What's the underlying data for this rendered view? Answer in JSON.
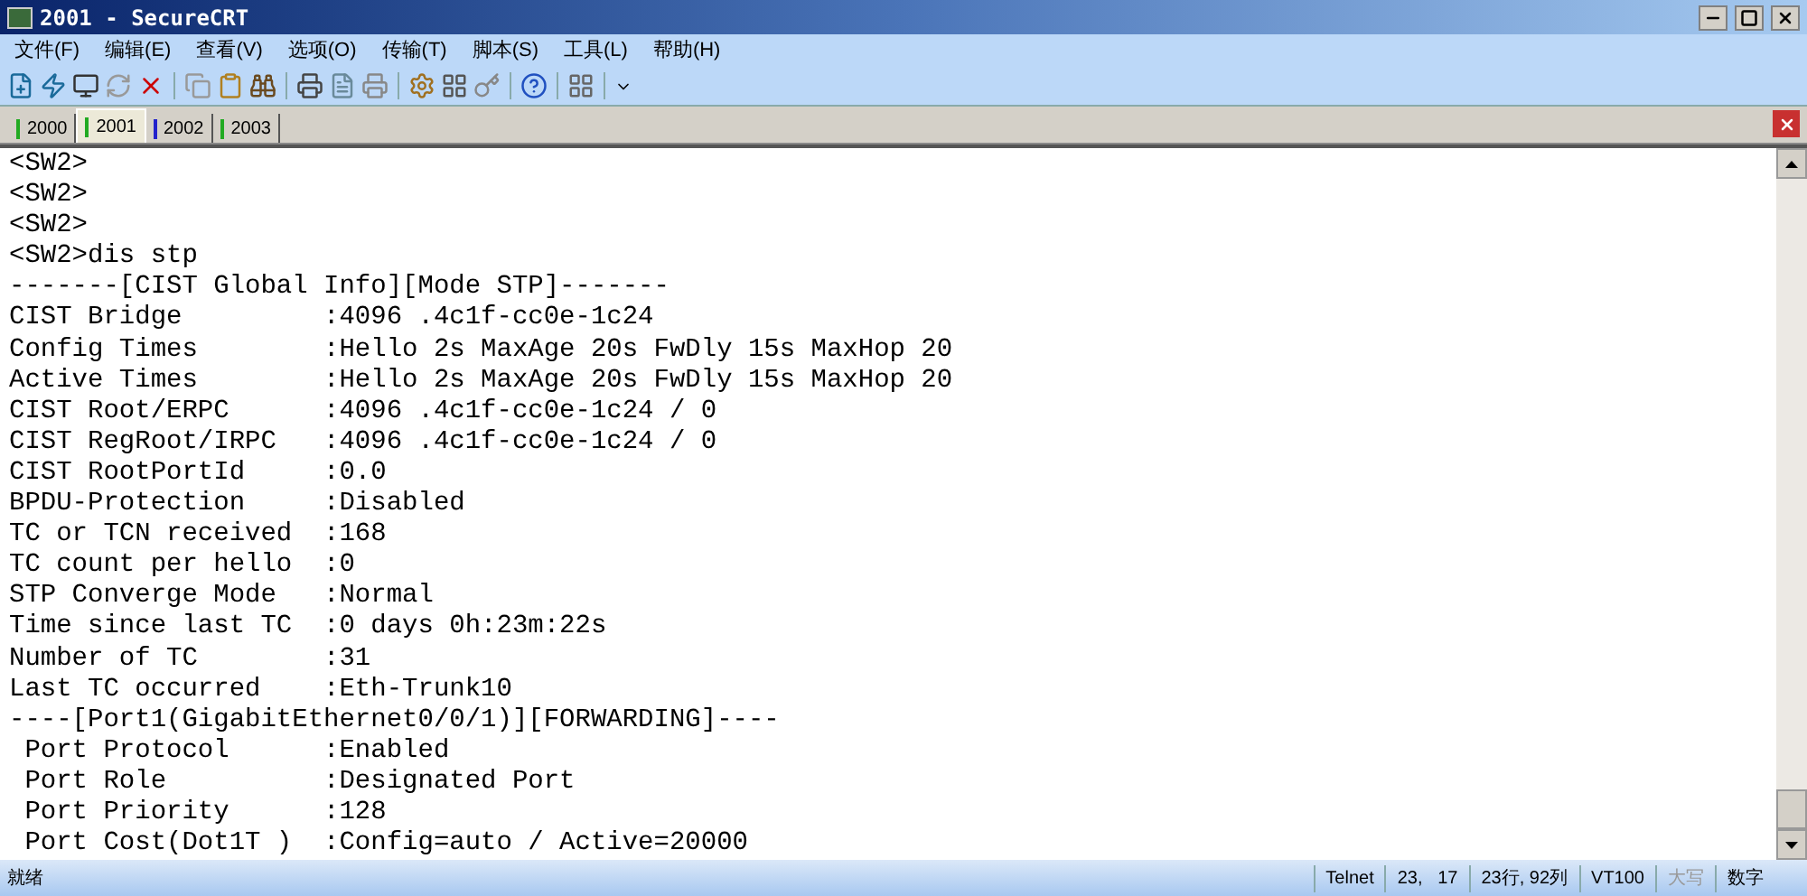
{
  "window": {
    "title": "2001 - SecureCRT"
  },
  "menu": [
    "文件(F)",
    "编辑(E)",
    "查看(V)",
    "选项(O)",
    "传输(T)",
    "脚本(S)",
    "工具(L)",
    "帮助(H)"
  ],
  "tabs": [
    {
      "label": "2000",
      "selected": false,
      "color": "#22aa22"
    },
    {
      "label": "2001",
      "selected": true,
      "color": "#22aa22"
    },
    {
      "label": "2002",
      "selected": false,
      "color": "#2222cc"
    },
    {
      "label": "2003",
      "selected": false,
      "color": "#22aa22"
    }
  ],
  "terminal": {
    "lines": [
      "<SW2>",
      "<SW2>",
      "<SW2>",
      "<SW2>dis stp",
      "-------[CIST Global Info][Mode STP]-------",
      "CIST Bridge         :4096 .4c1f-cc0e-1c24",
      "Config Times        :Hello 2s MaxAge 20s FwDly 15s MaxHop 20",
      "Active Times        :Hello 2s MaxAge 20s FwDly 15s MaxHop 20",
      "CIST Root/ERPC      :4096 .4c1f-cc0e-1c24 / 0",
      "CIST RegRoot/IRPC   :4096 .4c1f-cc0e-1c24 / 0",
      "CIST RootPortId     :0.0",
      "BPDU-Protection     :Disabled",
      "TC or TCN received  :168",
      "TC count per hello  :0",
      "STP Converge Mode   :Normal",
      "Time since last TC  :0 days 0h:23m:22s",
      "Number of TC        :31",
      "Last TC occurred    :Eth-Trunk10",
      "----[Port1(GigabitEthernet0/0/1)][FORWARDING]----",
      " Port Protocol      :Enabled",
      " Port Role          :Designated Port",
      " Port Priority      :128",
      " Port Cost(Dot1T )  :Config=auto / Active=20000"
    ]
  },
  "status_bar": {
    "message": "就绪",
    "fields": [
      {
        "text": "Telnet",
        "disabled": false
      },
      {
        "text": "23,   17",
        "disabled": false
      },
      {
        "text": "23行, 92列",
        "disabled": false
      },
      {
        "text": "VT100",
        "disabled": false
      },
      {
        "text": "大写",
        "disabled": true
      },
      {
        "text": "数字",
        "disabled": false
      }
    ]
  }
}
